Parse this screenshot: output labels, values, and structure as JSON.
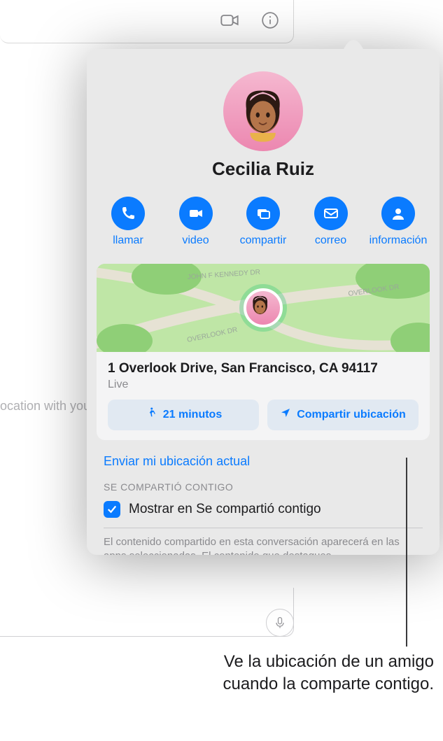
{
  "topbar": {
    "video_icon": "video",
    "info_icon": "info"
  },
  "background": {
    "partial_text": "ocation with you"
  },
  "contact": {
    "name": "Cecilia Ruiz"
  },
  "actions": {
    "call": "llamar",
    "video": "video",
    "share": "compartir",
    "mail": "correo",
    "info": "información"
  },
  "location": {
    "road_labels": [
      "JOHN F KENNEDY DR",
      "OVERLOOK DR",
      "OVERLOOK DR"
    ],
    "address": "1 Overlook Drive, San Francisco, CA 94117",
    "status": "Live",
    "walk_time": "21 minutos",
    "share_btn": "Compartir ubicación"
  },
  "links": {
    "send_current": "Enviar mi ubicación actual"
  },
  "shared": {
    "header": "SE COMPARTIÓ CONTIGO",
    "checkbox_label": "Mostrar en Se compartió contigo",
    "note": "El contenido compartido en esta conversación aparecerá en las apps seleccionadas. El contenido que destaques"
  },
  "caption": {
    "line1": "Ve la ubicación de un amigo",
    "line2": "cuando la comparte contigo."
  }
}
